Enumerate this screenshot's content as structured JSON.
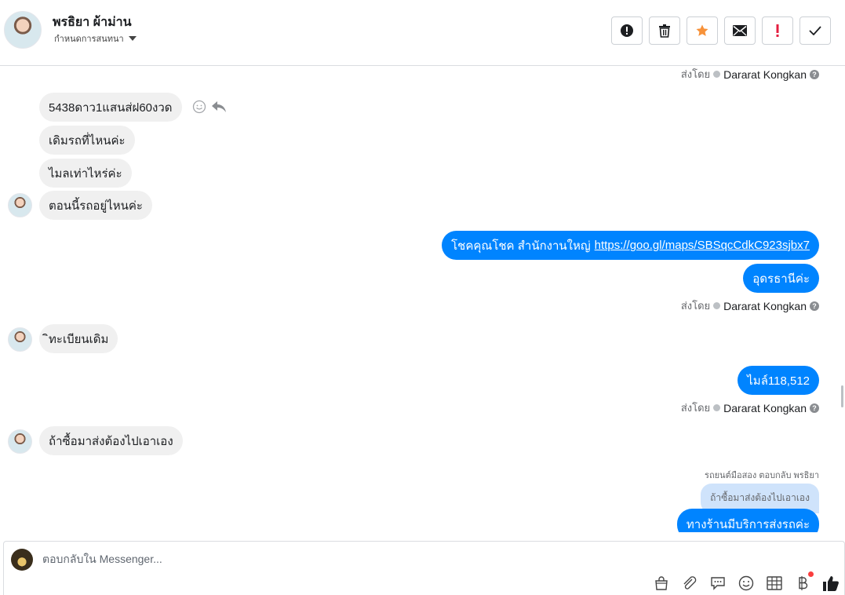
{
  "header": {
    "contact_name": "พรธิยา ผ้าม่าน",
    "assign_label": "กำหนดการสนทนา"
  },
  "toolbar": {
    "buttons": [
      {
        "name": "spam-button",
        "icon": "alert-circle-icon"
      },
      {
        "name": "delete-button",
        "icon": "trash-icon"
      },
      {
        "name": "star-button",
        "icon": "star-icon",
        "color": "#f7923a"
      },
      {
        "name": "mark-unread-button",
        "icon": "envelope-icon"
      },
      {
        "name": "important-button",
        "icon": "exclamation-icon",
        "color": "#e41e3f"
      },
      {
        "name": "done-button",
        "icon": "check-icon"
      }
    ]
  },
  "thread": {
    "sent_by_label": "ส่งโดย",
    "agent_name": "Dararat Kongkan",
    "messages_in_1": [
      "5438ดาว1แสนส่ฝ60งวด",
      "เดิมรถที่ไหนค่ะ",
      "ไมลเท่าไหร่ค่ะ",
      "ตอนนี้รถอยู่ไหนค่ะ"
    ],
    "out_1_text": "โชคคุณโชค สำนักงานใหญ่",
    "out_1_link": "https://goo.gl/maps/SBSqcCdkC923sjbx7",
    "out_2": "อุดรธานีค่ะ",
    "in_2": "ิทะเบียนเดิม",
    "out_3": "ไมล์118,512",
    "in_3": "ถ้าซื้อมาส่งต้องไปเอาเอง",
    "reply_meta": "รถยนต์มือสอง ตอบกลับ พรธิยา",
    "quoted_text": "ถ้าซื้อมาส่งต้องไปเอาเอง",
    "out_4": "ทางร้านมีบริการส่งรถค่ะ"
  },
  "composer": {
    "placeholder": "ตอบกลับใน Messenger...",
    "tools": [
      "shopping-bag-icon",
      "paperclip-icon",
      "chat-bubble-icon",
      "smiley-icon",
      "table-icon",
      "baht-icon",
      "thumbs-up-icon"
    ],
    "accent": "#0084ff"
  }
}
